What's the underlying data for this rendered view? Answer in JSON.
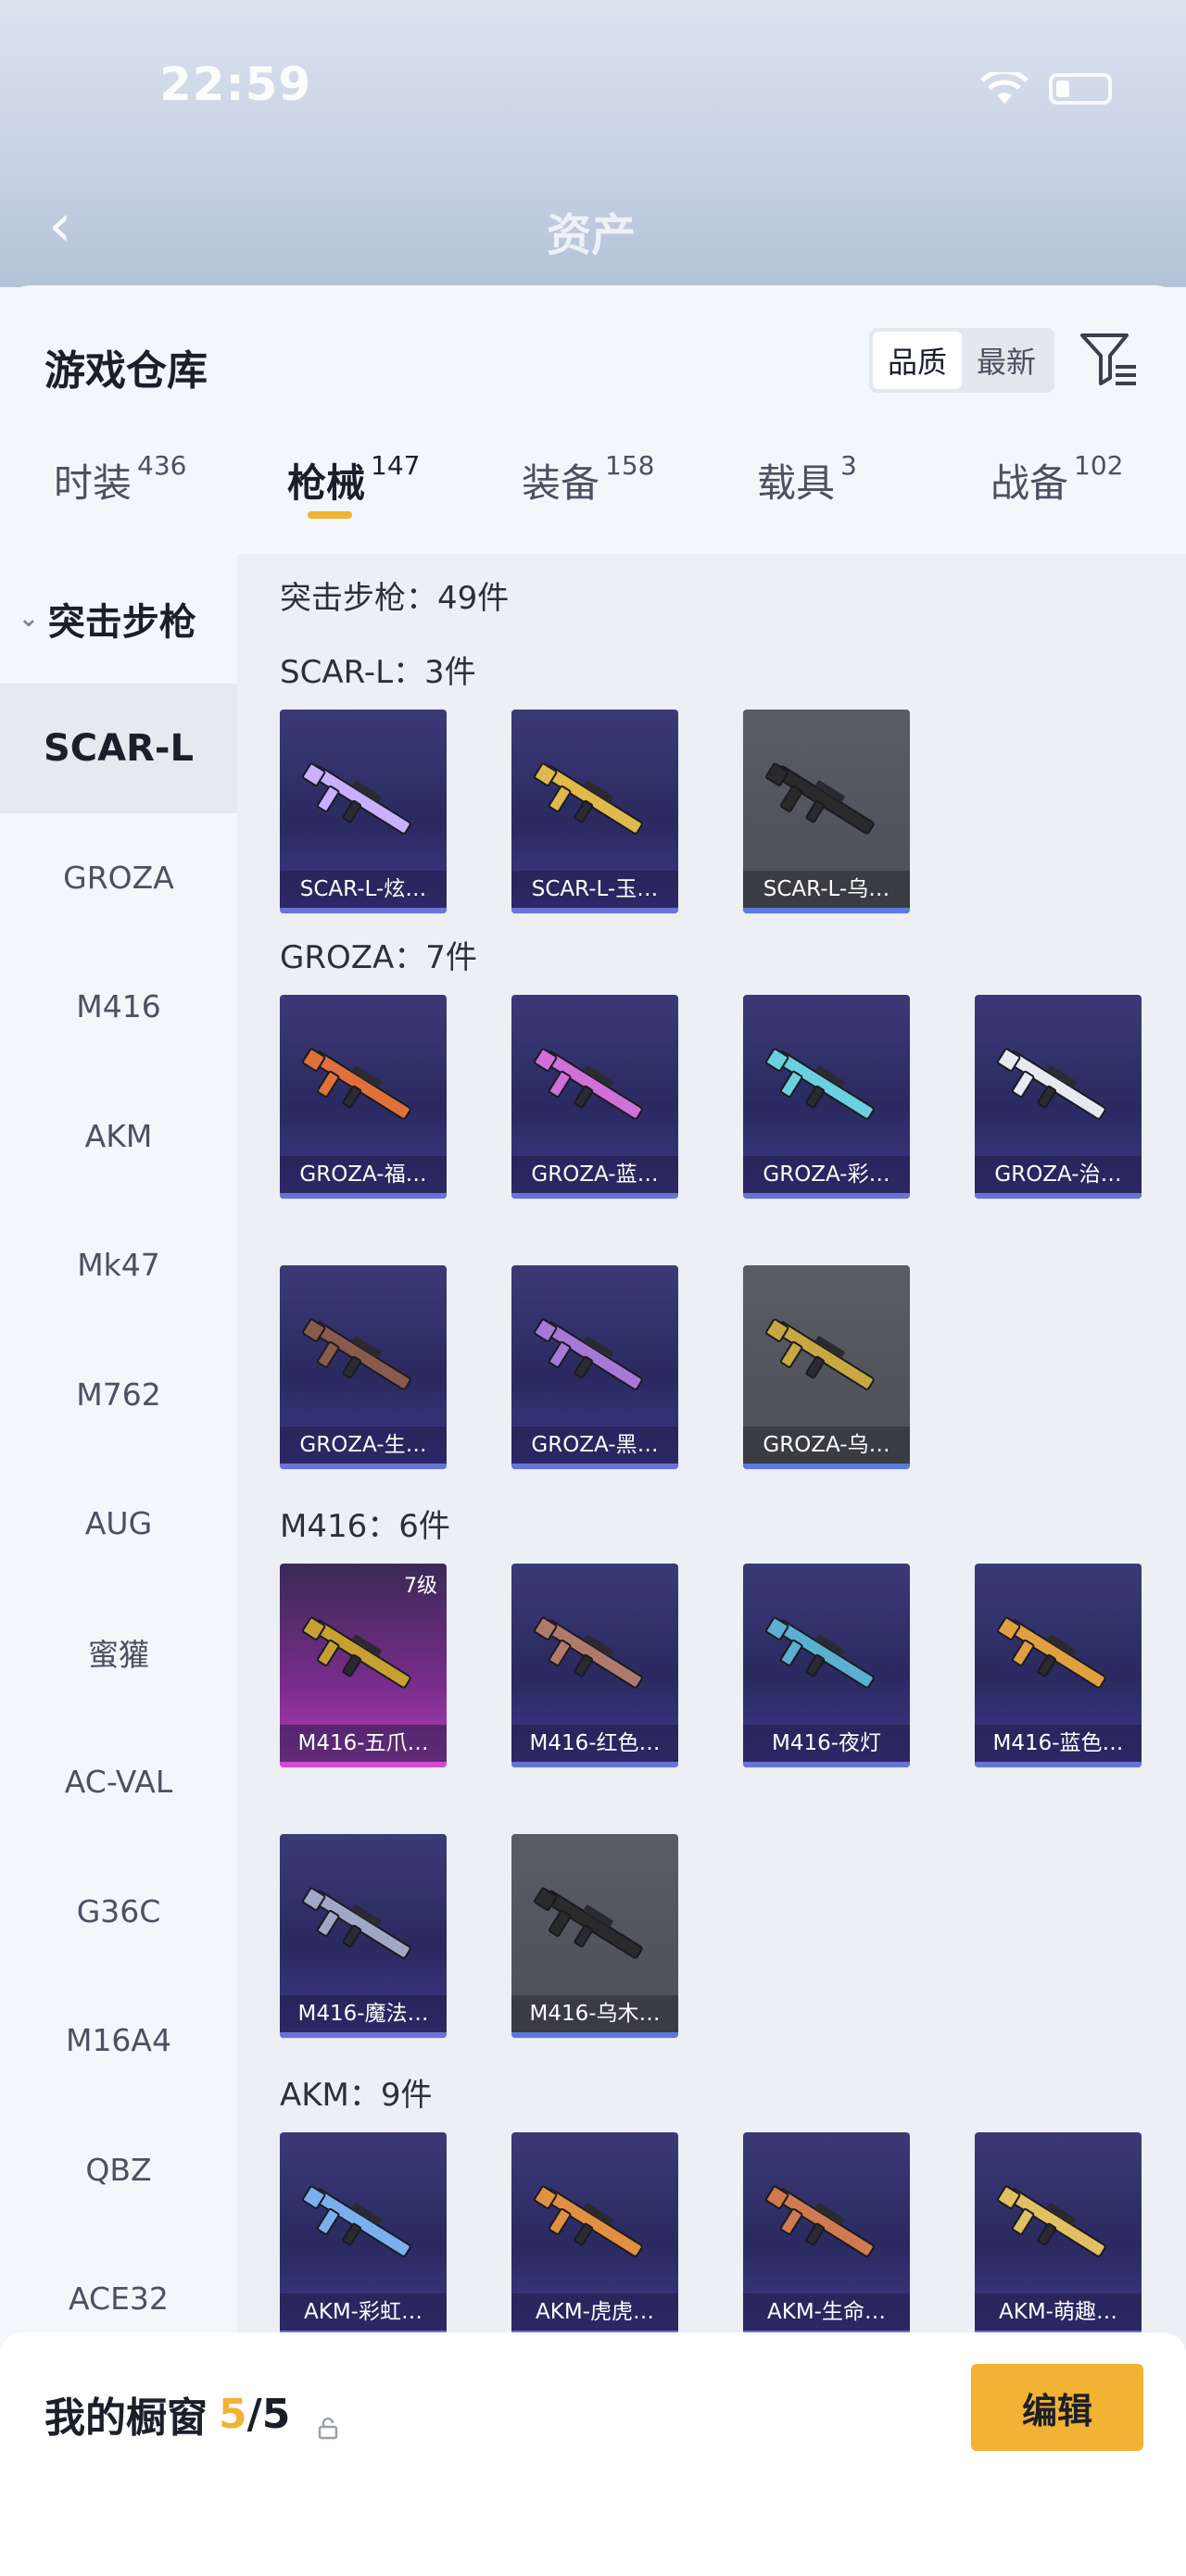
{
  "status": {
    "time": "22:59"
  },
  "nav": {
    "back_icon": "chevron-left-icon",
    "title": "资产"
  },
  "header": {
    "title": "游戏仓库",
    "sort_options": [
      "品质",
      "最新"
    ],
    "sort_selected": "品质"
  },
  "tabs": [
    {
      "label": "时装",
      "count": "436"
    },
    {
      "label": "枪械",
      "count": "147"
    },
    {
      "label": "装备",
      "count": "158"
    },
    {
      "label": "载具",
      "count": "3"
    },
    {
      "label": "战备",
      "count": "102"
    }
  ],
  "sidebar": {
    "category": "突击步枪",
    "items": [
      "SCAR-L",
      "GROZA",
      "M416",
      "AKM",
      "Mk47",
      "M762",
      "AUG",
      "蜜獾",
      "AC-VAL",
      "G36C",
      "M16A4",
      "QBZ",
      "ACE32"
    ],
    "active": "SCAR-L"
  },
  "content": {
    "total": "突击步枪：49件",
    "groups": [
      {
        "title": "SCAR-L：3件",
        "items": [
          {
            "name": "SCAR-L-炫…",
            "rarity": "purple",
            "color": "#c9b0ff"
          },
          {
            "name": "SCAR-L-玉…",
            "rarity": "purple",
            "color": "#e0b84c"
          },
          {
            "name": "SCAR-L-乌…",
            "rarity": "gray",
            "color": "#2a2a2a"
          }
        ]
      },
      {
        "title": "GROZA：7件",
        "items": [
          {
            "name": "GROZA-福…",
            "rarity": "purple",
            "color": "#e0703a"
          },
          {
            "name": "GROZA-蓝…",
            "rarity": "purple",
            "color": "#d070d8"
          },
          {
            "name": "GROZA-彩…",
            "rarity": "purple",
            "color": "#6ad0e0"
          },
          {
            "name": "GROZA-治…",
            "rarity": "purple",
            "color": "#e8e8f0"
          },
          {
            "name": "GROZA-生…",
            "rarity": "purple",
            "color": "#8a5a4a"
          },
          {
            "name": "GROZA-黑…",
            "rarity": "purple",
            "color": "#a878d8"
          },
          {
            "name": "GROZA-乌…",
            "rarity": "gray",
            "color": "#c8a840"
          }
        ]
      },
      {
        "title": "M416：6件",
        "items": [
          {
            "name": "M416-五爪…",
            "rarity": "pink",
            "color": "#c8a030",
            "level": "7级"
          },
          {
            "name": "M416-红色…",
            "rarity": "purple",
            "color": "#b07a6a"
          },
          {
            "name": "M416-夜灯",
            "rarity": "purple",
            "color": "#5ab0d0"
          },
          {
            "name": "M416-蓝色…",
            "rarity": "purple",
            "color": "#e0a040"
          },
          {
            "name": "M416-魔法…",
            "rarity": "purple",
            "color": "#a0a8c8"
          },
          {
            "name": "M416-乌木…",
            "rarity": "gray",
            "color": "#2a2a2a"
          }
        ]
      },
      {
        "title": "AKM：9件",
        "items": [
          {
            "name": "AKM-彩虹…",
            "rarity": "purple",
            "color": "#7ab0f0"
          },
          {
            "name": "AKM-虎虎…",
            "rarity": "purple",
            "color": "#e09040"
          },
          {
            "name": "AKM-生命…",
            "rarity": "purple",
            "color": "#d07a50"
          },
          {
            "name": "AKM-萌趣…",
            "rarity": "purple",
            "color": "#e0c060"
          }
        ]
      }
    ]
  },
  "fab": {
    "icon": "share-external-icon"
  },
  "showcase": {
    "label": "我的橱窗",
    "current": "5",
    "total": "/5",
    "lock_icon": "lock-icon",
    "edit_label": "编辑"
  },
  "colors": {
    "accent": "#f2b233",
    "purple_card": "#2a2a60",
    "pink_card": "#b840b8",
    "gray_card": "#4d4f56"
  }
}
